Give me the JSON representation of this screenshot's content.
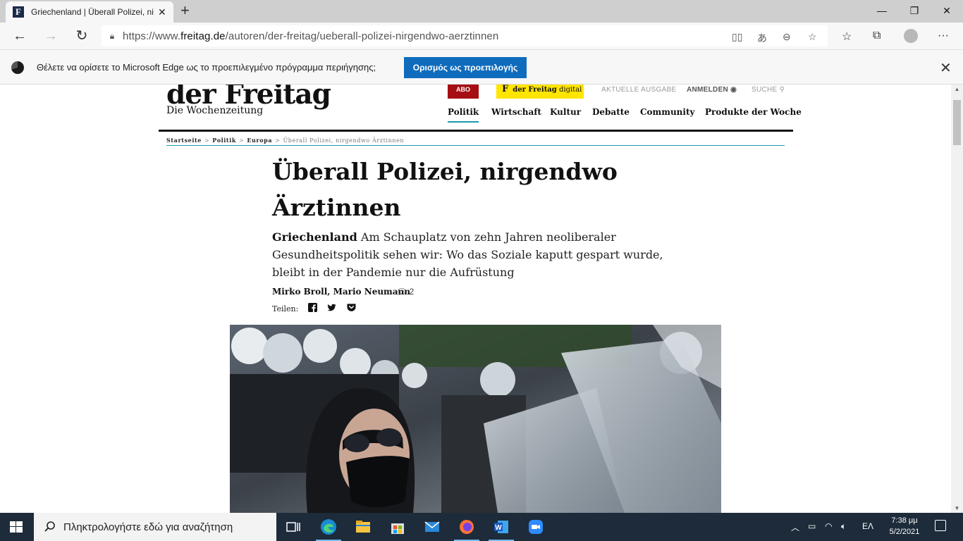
{
  "browser": {
    "tab_title": "Griechenland | Überall Polizei, nirgendwo Ärztinnen",
    "favicon_letter": "F",
    "url_prefix": "https://www.",
    "url_domain": "freitag.de",
    "url_path": "/autoren/der-freitag/ueberall-polizei-nirgendwo-aerztinnen",
    "infobar_text": "Θέλετε να ορίσετε το Microsoft Edge ως το προεπιλεγμένο πρόγραμμα περιήγησης;",
    "infobar_button": "Ορισμός ως προεπιλογής"
  },
  "site": {
    "logo": "der Freitag",
    "logo_sub": "Die Wochenzeitung",
    "abo": "ABO",
    "digital_f": "F",
    "digital_brand": "der Freitag",
    "digital_suffix": "digital",
    "current_issue": "AKTUELLE AUSGABE",
    "login": "ANMELDEN",
    "search": "SUCHE",
    "nav": [
      "Politik",
      "Wirtschaft",
      "Kultur",
      "Debatte",
      "Community",
      "Produkte der Woche"
    ]
  },
  "breadcrumb": {
    "items": [
      "Startseite",
      "Politik",
      "Europa"
    ],
    "current": "Überall Polizei, nirgendwo Ärztinnen",
    "separator": ">"
  },
  "article": {
    "headline": "Überall Polizei, nirgendwo Ärztinnen",
    "kicker": "Griechenland",
    "standfirst": "Am Schauplatz von zehn Jahren neoliberaler Gesundheitspolitik sehen wir: Wo das Soziale kaputt gespart wurde, bleibt in der Pandemie nur die Aufrüstung",
    "authors": "Mirko Broll, Mario Neumann",
    "comment_count": "2",
    "share_label": "Teilen:"
  },
  "taskbar": {
    "search_placeholder": "Πληκτρολογήστε εδώ για αναζήτηση",
    "language": "ΕΛ",
    "time": "7:38 μμ",
    "date": "5/2/2021"
  },
  "colors": {
    "accent_teal": "#1a9ab0",
    "abo_red": "#a50f13",
    "digital_yellow": "#ffe500",
    "edge_button": "#0f6cbd",
    "taskbar": "#1d2b3a"
  }
}
